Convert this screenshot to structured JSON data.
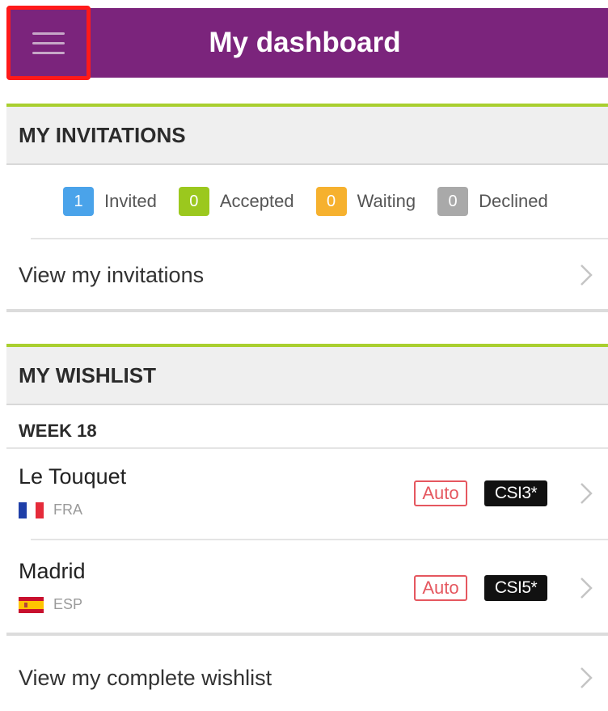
{
  "header": {
    "title": "My dashboard",
    "menu_icon": "hamburger-icon",
    "color": "#7b247c"
  },
  "invitations": {
    "title": "MY INVITATIONS",
    "counts": [
      {
        "value": "1",
        "label": "Invited",
        "color": "#4aa3ea"
      },
      {
        "value": "0",
        "label": "Accepted",
        "color": "#9bc81e"
      },
      {
        "value": "0",
        "label": "Waiting",
        "color": "#f6b12e"
      },
      {
        "value": "0",
        "label": "Declined",
        "color": "#a9a9a9"
      }
    ],
    "link_label": "View my invitations"
  },
  "wishlist": {
    "title": "MY WISHLIST",
    "week_label": "WEEK 18",
    "events": [
      {
        "name": "Le Touquet",
        "country": "FRA",
        "flag": "france-flag-icon",
        "auto": "Auto",
        "level": "CSI3*"
      },
      {
        "name": "Madrid",
        "country": "ESP",
        "flag": "spain-flag-icon",
        "auto": "Auto",
        "level": "CSI5*"
      }
    ],
    "link_label": "View my complete wishlist"
  },
  "accent_color": "#a9cf2f"
}
